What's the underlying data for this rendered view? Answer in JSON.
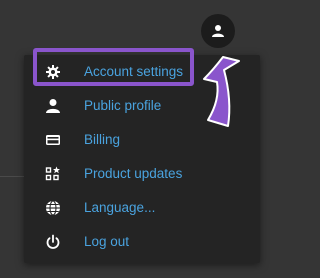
{
  "header": {
    "avatar_icon": "user-icon"
  },
  "menu": {
    "items": [
      {
        "label": "Account settings",
        "icon": "gear-icon"
      },
      {
        "label": "Public profile",
        "icon": "user-icon"
      },
      {
        "label": "Billing",
        "icon": "credit-card-icon"
      },
      {
        "label": "Product updates",
        "icon": "apps-star-icon"
      },
      {
        "label": "Language...",
        "icon": "globe-icon"
      },
      {
        "label": "Log out",
        "icon": "power-icon"
      }
    ]
  },
  "annotation": {
    "highlight_color": "#8a55cc",
    "arrow_color": "#8a55cc"
  },
  "colors": {
    "link": "#4aa3df",
    "menu_background": "#242424",
    "page_background": "#353535"
  }
}
